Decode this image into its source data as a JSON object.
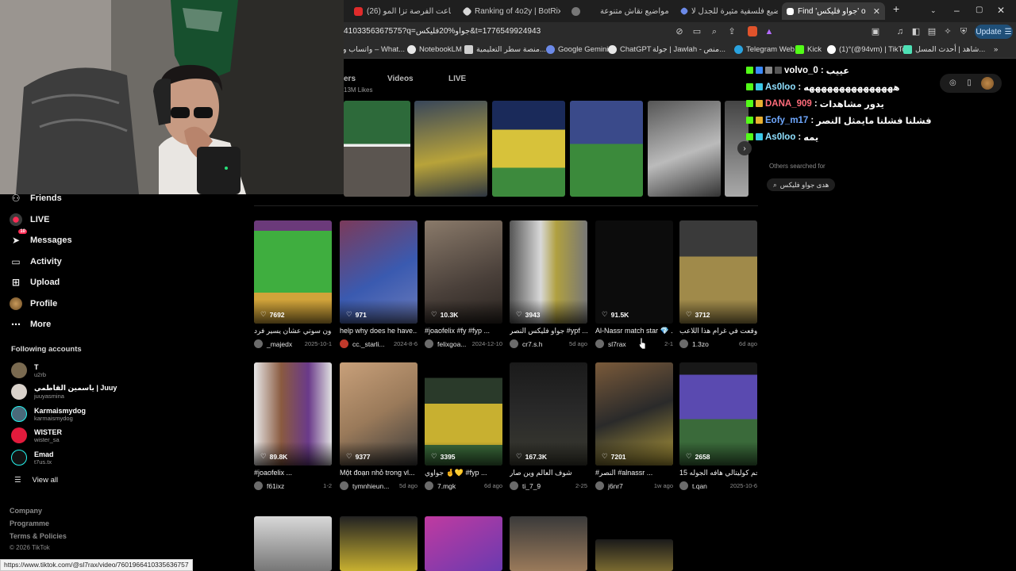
{
  "browser": {
    "tabs": [
      {
        "title": "لا ضاعت الفرصة تزا المو (26)",
        "fav": "#e02b2b",
        "icon": "youtube-icon"
      },
      {
        "title": "Ranking of 4o2y | BotRix —",
        "fav": "#d7d7d7",
        "icon": "botrix-icon"
      },
      {
        "title": "مواضيع نقاش متنوعة",
        "fav": "#8a8a8a",
        "icon": "chat-icon"
      },
      {
        "title": "مواضيع فلسفية مثيرة للجدل لا",
        "fav": "#6c8ae8",
        "icon": "gemini-icon"
      },
      {
        "title": "Find 'جواو فليكس' on TikT",
        "fav": "#ffffff",
        "icon": "tiktok-icon"
      }
    ],
    "url": "4103356367575?q=جواو%20فليكس&t=1776549924943",
    "update_label": "Update",
    "bookmarks": [
      {
        "label": "واتساب ويب – What...",
        "color": "#25d366"
      },
      {
        "label": "NotebookLM",
        "color": "#e8e8e8"
      },
      {
        "label": "منصة سطر التعليمية...",
        "color": "#d0d0d0"
      },
      {
        "label": "Google Gemini",
        "color": "#6c8ae8"
      },
      {
        "label": "ChatGPT",
        "color": "#e8e8e8"
      },
      {
        "label": "جولة | Jawlah - منص...",
        "color": "#f2b233"
      },
      {
        "label": "Telegram Web",
        "color": "#2aa3df"
      },
      {
        "label": "Kick",
        "color": "#53fc18"
      },
      {
        "label": "(1)°(@94vm) | TikTok",
        "color": "#ffffff"
      },
      {
        "label": "شاهد | أحدث المسل...",
        "color": "#4ee0b5"
      }
    ]
  },
  "profile": {
    "tabs": [
      "ers",
      "Videos",
      "LIVE"
    ],
    "likes": "13M Likes"
  },
  "sidebar": {
    "nav": [
      {
        "label": "Friends",
        "icon": "friends-icon"
      },
      {
        "label": "LIVE",
        "icon": "live-icon"
      },
      {
        "label": "Messages",
        "icon": "messages-icon",
        "badge": "10"
      },
      {
        "label": "Activity",
        "icon": "activity-icon"
      },
      {
        "label": "Upload",
        "icon": "upload-icon"
      },
      {
        "label": "Profile",
        "icon": "profile-avatar-icon"
      },
      {
        "label": "More",
        "icon": "more-icon"
      }
    ],
    "following_title": "Following accounts",
    "accounts": [
      {
        "name": "T",
        "handle": "u2rb"
      },
      {
        "name": "ياسمين القاطمي | Juuy",
        "handle": "juuyasmina"
      },
      {
        "name": "Karmaismydog",
        "handle": "karmaismydog"
      },
      {
        "name": "WISTER",
        "handle": "wister_sa"
      },
      {
        "name": "Emad",
        "handle": "t7us.tx"
      }
    ],
    "view_all": "View all",
    "footer": [
      "Company",
      "Programme",
      "Terms & Policies"
    ],
    "copyright": "© 2026 TikTok"
  },
  "videos_row1": [
    {
      "views": "7692",
      "title": "يشحدون سوتي عشان يسير فرد...",
      "user": "_majedx",
      "date": "2025-10-1"
    },
    {
      "views": "971",
      "title": "help why does he have...",
      "user": "cc._starli...",
      "date": "2024-8-6"
    },
    {
      "views": "10.3K",
      "title": "#joaofelix #fy #fyp ...",
      "user": "felixgoa...",
      "date": "2024-12-10"
    },
    {
      "views": "3943",
      "title": "جواو فليكس النصر #ypf ...",
      "user": "cr7.s.h",
      "date": "5d ago"
    },
    {
      "views": "91.5K",
      "title": "Al-Nassr match star 💎 ...",
      "user": "sl7rax",
      "date": "2-1"
    },
    {
      "views": "3712",
      "title": "انا وقعت في غرام هذا اللاعب ...",
      "user": "1.3zo",
      "date": "6d ago"
    }
  ],
  "videos_row2": [
    {
      "views": "89.8K",
      "title": "#joaofelix ...",
      "user": "f61ixz",
      "date": "1-2"
    },
    {
      "views": "9377",
      "title": "Một đoạn nhỏ trong vl...",
      "user": "tymnhieun...",
      "date": "5d ago"
    },
    {
      "views": "3395",
      "title": "جواوي 🤞💛 #fyp ...",
      "user": "7.mgk",
      "date": "6d ago"
    },
    {
      "views": "167.3K",
      "title": "شوف العالم وين صار",
      "user": "ti_7_9",
      "date": "2-25"
    },
    {
      "views": "7201",
      "title": "#النصر #alnassr ...",
      "user": "j6nr7",
      "date": "1w ago"
    },
    {
      "views": "2658",
      "title": "15 ـي الحم كوليتالي هافه الجوله",
      "user": "t.qan",
      "date": "2025-10-6"
    }
  ],
  "chat": [
    {
      "user": "volvo_0",
      "msg": "عييب",
      "color": "#ffffff"
    },
    {
      "user": "As0loo",
      "msg": "هههههههههههههههه",
      "color": "#8fe0ff"
    },
    {
      "user": "DANA_909",
      "msg": "يدور مشاهدات",
      "color": "#ff6b7a"
    },
    {
      "user": "Eofy_m17",
      "msg": "فشلنا فشلنا مايمثل النصر",
      "color": "#6fa8ff"
    },
    {
      "user": "As0loo",
      "msg": "يمه",
      "color": "#8fe0ff"
    }
  ],
  "others_searched": "Others searched for",
  "search_suggestion": "هدى جواو فليكس",
  "status_url": "https://www.tiktok.com/@sl7rax/video/7601966410335636757"
}
